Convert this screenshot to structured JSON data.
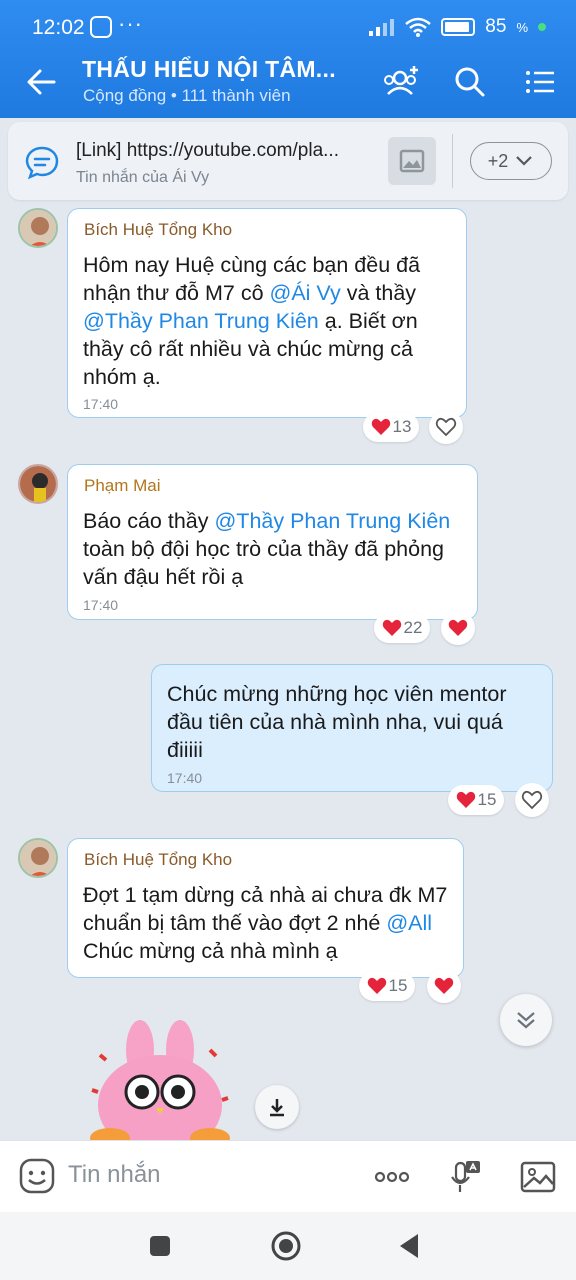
{
  "status_bar": {
    "time": "12:02",
    "dots": "···",
    "battery": "85"
  },
  "header": {
    "title": "THẤU HIỂU NỘI TÂM...",
    "subtitle": "Cộng đồng • 111 thành viên"
  },
  "pinned": {
    "title": "[Link] https://youtube.com/pla...",
    "subtitle": "Tin nhắn của Ái Vy",
    "more_label": "+2"
  },
  "messages": [
    {
      "sender": "Bích Huệ Tổng Kho",
      "sender_color": "#8a5a2a",
      "text_parts": [
        "Hôm nay Huệ cùng các bạn đều đã nhận thư đỗ M7 cô ",
        "@Ái Vy",
        " và thầy ",
        "@Thầy Phan Trung Kiên",
        "  ạ. Biết ơn thầy cô rất nhiều và chúc mừng cả nhóm ạ."
      ],
      "time": "17:40",
      "reaction_count": "13"
    },
    {
      "sender": "Phạm Mai",
      "sender_color": "#b0771c",
      "text_parts": [
        "Báo cáo thầy ",
        "@Thầy Phan Trung Kiên",
        " toàn bộ đội học trò của thầy đã phỏng vấn đậu hết rồi ạ"
      ],
      "time": "17:40",
      "reaction_count": "22"
    },
    {
      "text": "Chúc mừng những học viên mentor đầu tiên của nhà mình nha, vui quá điiiii",
      "time": "17:40",
      "reaction_count": "15"
    },
    {
      "sender": "Bích Huệ Tổng Kho",
      "sender_color": "#8a5a2a",
      "text_parts": [
        "Đợt 1 tạm dừng cả nhà ai chưa đk M7 chuẩn bị tâm thế vào đợt 2 nhé ",
        "@All",
        "  Chúc mừng cả nhà mình ạ"
      ],
      "time": "",
      "reaction_count": "15"
    }
  ],
  "input": {
    "placeholder": "Tin nhắn"
  },
  "colors": {
    "header": "#2280e8",
    "mention": "#1f88e5",
    "heart": "#e5243b",
    "bubble_border": "#9fcdf0"
  }
}
